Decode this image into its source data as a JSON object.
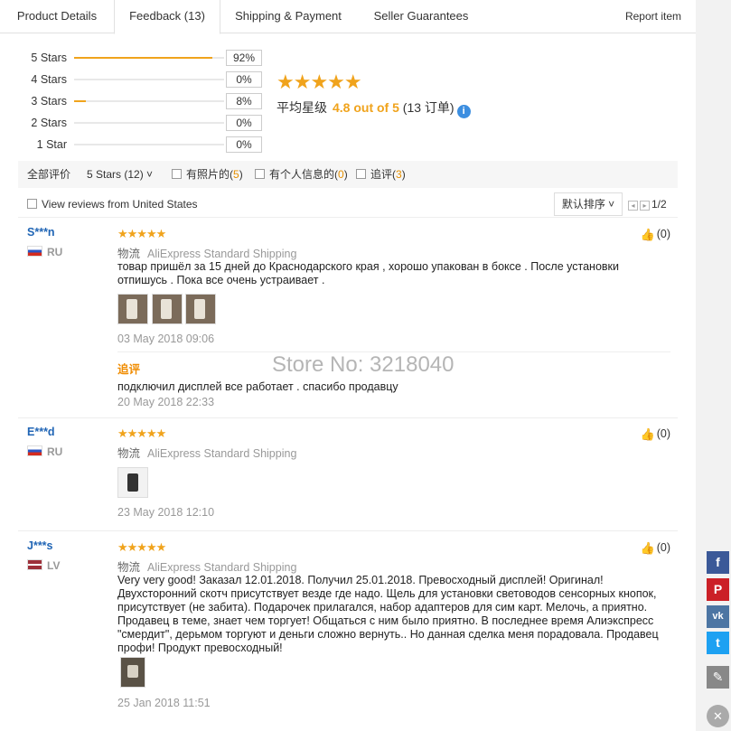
{
  "tabs": [
    {
      "label": "Product Details"
    },
    {
      "label": "Feedback (13)"
    },
    {
      "label": "Shipping & Payment"
    },
    {
      "label": "Seller Guarantees"
    }
  ],
  "report_label": "Report item",
  "rating_breakdown": [
    {
      "label": "5 Stars",
      "percent_text": "92%",
      "fraction": 0.92
    },
    {
      "label": "4 Stars",
      "percent_text": "0%",
      "fraction": 0
    },
    {
      "label": "3 Stars",
      "percent_text": "8%",
      "fraction": 0.08
    },
    {
      "label": "2 Stars",
      "percent_text": "0%",
      "fraction": 0
    },
    {
      "label": "1 Star",
      "percent_text": "0%",
      "fraction": 0
    }
  ],
  "summary": {
    "stars": "★★★★★",
    "avg_label": "平均星级",
    "avg_score": "4.8 out of 5",
    "order_count": "(13 订单)",
    "info_icon": "i"
  },
  "filters": {
    "all_label": "全部评价",
    "stars_select": "5 Stars (12)",
    "stars_chevron": "˅",
    "photos_label": "有照片的",
    "photos_count": "5",
    "personal_label": "有个人信息的",
    "personal_count": "0",
    "append_label": "追评",
    "append_count": "3",
    "country_label": "View reviews from United States",
    "sort_label": "默认排序",
    "sort_chevron": "˅",
    "prev_icon": "◂",
    "next_icon": "▸",
    "page": "1/2"
  },
  "watermark": "Store No: 3218040",
  "reviews": [
    {
      "user": "S***n",
      "country": "RU",
      "stars": "★★★★★",
      "ship_key": "物流",
      "ship_value": "AliExpress Standard Shipping",
      "text": "товар пришёл за 15 дней до Краснодарского края , хорошо упакован в боксе . После установки отпишусь . Пока все очень устраивает .",
      "date": "03 May 2018 09:06",
      "followup_label": "追评",
      "followup_text": "подключил дисплей все работает . спасибо продавцу",
      "followup_date": "20 May 2018 22:33",
      "likes": "(0)"
    },
    {
      "user": "E***d",
      "country": "RU",
      "stars": "★★★★★",
      "ship_key": "物流",
      "ship_value": "AliExpress Standard Shipping",
      "date": "23 May 2018 12:10",
      "likes": "(0)"
    },
    {
      "user": "J***s",
      "country": "LV",
      "stars": "★★★★★",
      "ship_key": "物流",
      "ship_value": "AliExpress Standard Shipping",
      "text": "Very very good! Заказал 12.01.2018. Получил 25.01.2018. Превосходный дисплей! Оригинал! Двухсторонний скотч присутствует везде где надо. Щель для установки световодов сенсорных кнопок, присутствует (не забита). Подарочек прилагался, набор адаптеров для сим карт. Мелочь, а приятно. Продавец в теме, знает чем торгует! Общаться с ним было приятно. В последнее время Алиэкспресс \"смердит\", дерьмом торгуют и деньги сложно вернуть.. Но данная сделка меня порадовала. Продавец профи! Продукт превосходный!",
      "date": "25 Jan 2018 11:51",
      "likes": "(0)"
    }
  ],
  "share": {
    "facebook": "f",
    "pinterest": "P",
    "vk": "vk",
    "twitter": "t",
    "edit_icon": "✎",
    "close_icon": "✕",
    "colors": {
      "facebook": "#3b5998",
      "pinterest": "#cb2027",
      "vk": "#4c75a3",
      "twitter": "#1da1f2",
      "edit": "#888888",
      "close": "#aaaaaa"
    }
  },
  "colors": {
    "accent": "#f0a31c",
    "link": "#2065b5",
    "followup": "#f08c00"
  }
}
